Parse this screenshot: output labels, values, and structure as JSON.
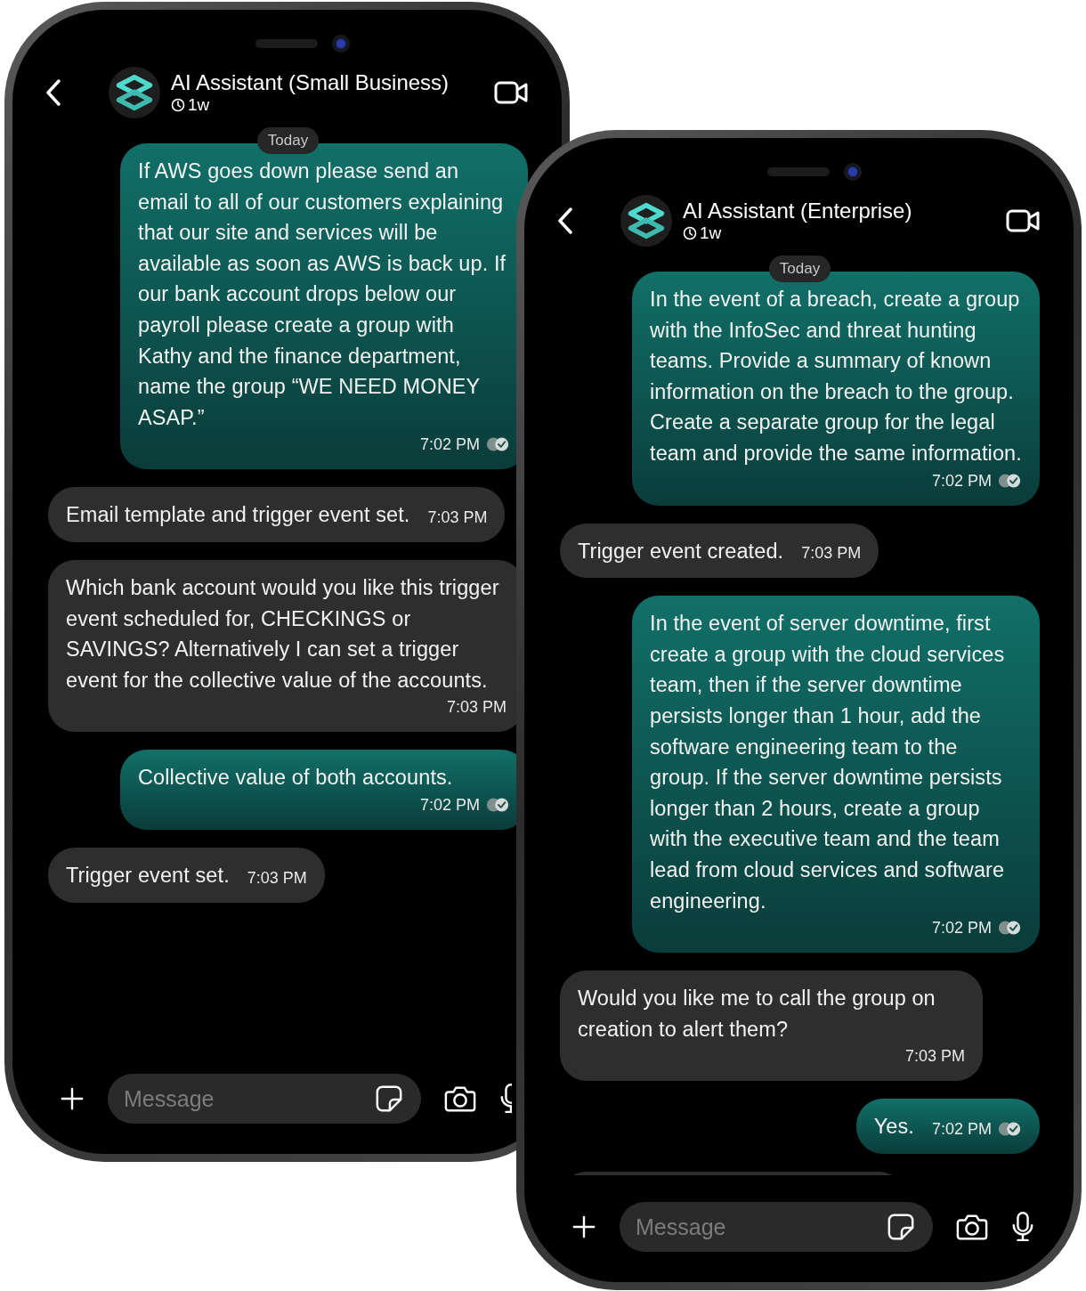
{
  "phones": [
    {
      "contact": {
        "name": "AI Assistant (Small Business)",
        "last_seen": "1w"
      },
      "date_divider": "Today",
      "cut_off_message": false,
      "messages": [
        {
          "kind": "sent",
          "text": "If AWS goes down please send an email to all of our customers explaining that our site and services will be available as soon as AWS is back up. If our bank account drops below our payroll please create a group with Kathy and the finance department, name the group “WE NEED MONEY ASAP.”",
          "time": "7:02 PM"
        },
        {
          "kind": "received",
          "text": "Email template and trigger event set.",
          "time": "7:03 PM"
        },
        {
          "kind": "received",
          "text": "Which bank account would you like this trigger event scheduled for, CHECKINGS or SAVINGS? Alternatively I can set a trigger event for the collective value of the accounts.",
          "time": "7:03 PM"
        },
        {
          "kind": "sent",
          "text": "Collective value of both accounts.",
          "time": "7:02 PM"
        },
        {
          "kind": "received",
          "text": "Trigger event set.",
          "time": "7:03 PM"
        }
      ],
      "composer": {
        "placeholder": "Message"
      }
    },
    {
      "contact": {
        "name": "AI Assistant (Enterprise)",
        "last_seen": "1w"
      },
      "date_divider": "Today",
      "cut_off_message": true,
      "messages": [
        {
          "kind": "sent",
          "text": "In the event of a breach, create a group with the InfoSec and threat hunting teams. Provide a summary of known information on the breach to the group. Create a separate group for the legal team and provide the same information.",
          "time": "7:02 PM"
        },
        {
          "kind": "received",
          "text": "Trigger event created.",
          "time": "7:03 PM"
        },
        {
          "kind": "sent",
          "text": "In the event of server downtime, first create a group with the cloud services team, then if the server downtime persists longer than 1 hour, add the software engineering team to the group. If the server downtime persists longer than 2 hours, create a group with the executive team and the team lead from cloud services and software engineering.",
          "time": "7:02 PM"
        },
        {
          "kind": "received",
          "text": "Would you like me to call the group on creation to alert them?",
          "time": "7:03 PM"
        },
        {
          "kind": "sent",
          "text": "Yes.",
          "time": "7:02 PM"
        }
      ],
      "composer": {
        "placeholder": "Message"
      }
    }
  ]
}
